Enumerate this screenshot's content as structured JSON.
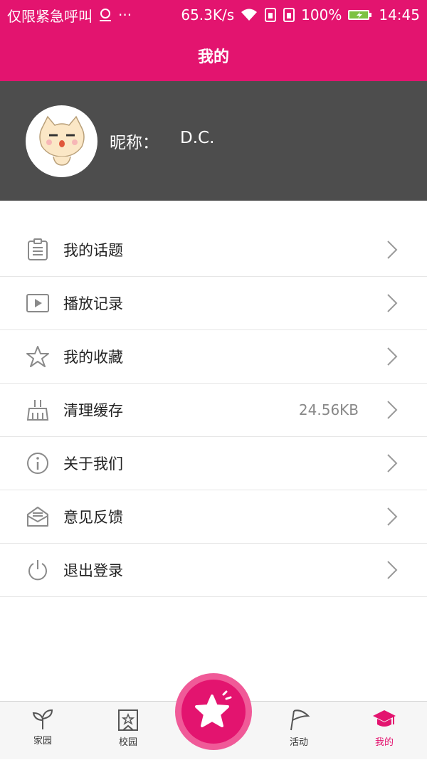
{
  "status": {
    "carrier": "仅限紧急呼叫",
    "speed": "65.3K/s",
    "battery": "100%",
    "time": "14:45"
  },
  "header": {
    "title": "我的"
  },
  "profile": {
    "nick_label": "昵称：",
    "nick_value": "D.C."
  },
  "menu": {
    "items": [
      {
        "label": "我的话题",
        "icon": "clipboard-icon"
      },
      {
        "label": "播放记录",
        "icon": "play-icon"
      },
      {
        "label": "我的收藏",
        "icon": "star-icon"
      },
      {
        "label": "清理缓存",
        "icon": "broom-icon",
        "value": "24.56KB"
      },
      {
        "label": "关于我们",
        "icon": "info-icon"
      },
      {
        "label": "意见反馈",
        "icon": "mail-icon"
      },
      {
        "label": "退出登录",
        "icon": "power-icon"
      }
    ]
  },
  "tabs": [
    {
      "label": "家园",
      "icon": "sprout-icon"
    },
    {
      "label": "校园",
      "icon": "badge-star-icon"
    },
    {
      "label": "活动",
      "icon": "flag-icon"
    },
    {
      "label": "我的",
      "icon": "graduation-cap-icon",
      "active": true
    }
  ],
  "colors": {
    "accent": "#e3146f",
    "profile_bg": "#4d4d4d"
  }
}
